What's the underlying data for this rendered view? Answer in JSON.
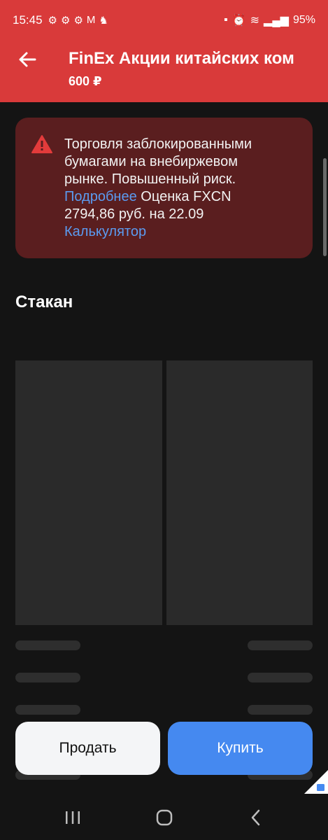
{
  "status_bar": {
    "time": "15:45",
    "left_icons": [
      "notification-icon",
      "notification-icon",
      "notification-icon",
      "gmail-icon",
      "app-icon"
    ],
    "battery": "95%"
  },
  "header": {
    "title": "FinEx Акции китайских ком",
    "price": "600 ₽",
    "background": "#d93a3a"
  },
  "warning": {
    "text_1": "Торговля заблокированными бумагами на внебиржевом рынке. Повышенный риск. ",
    "link_more": "Подробнее",
    "text_2": " Оценка FXCN 2794,86 руб. на 22.09",
    "link_calc": "Калькулятор",
    "background": "#5a1e1f",
    "link_color": "#5b9bf0"
  },
  "orderbook": {
    "title": "Стакан"
  },
  "actions": {
    "sell_label": "Продать",
    "buy_label": "Купить",
    "buy_color": "#4589f0"
  },
  "nav": {
    "icons": [
      "recent-apps-icon",
      "home-icon",
      "back-nav-icon"
    ]
  }
}
